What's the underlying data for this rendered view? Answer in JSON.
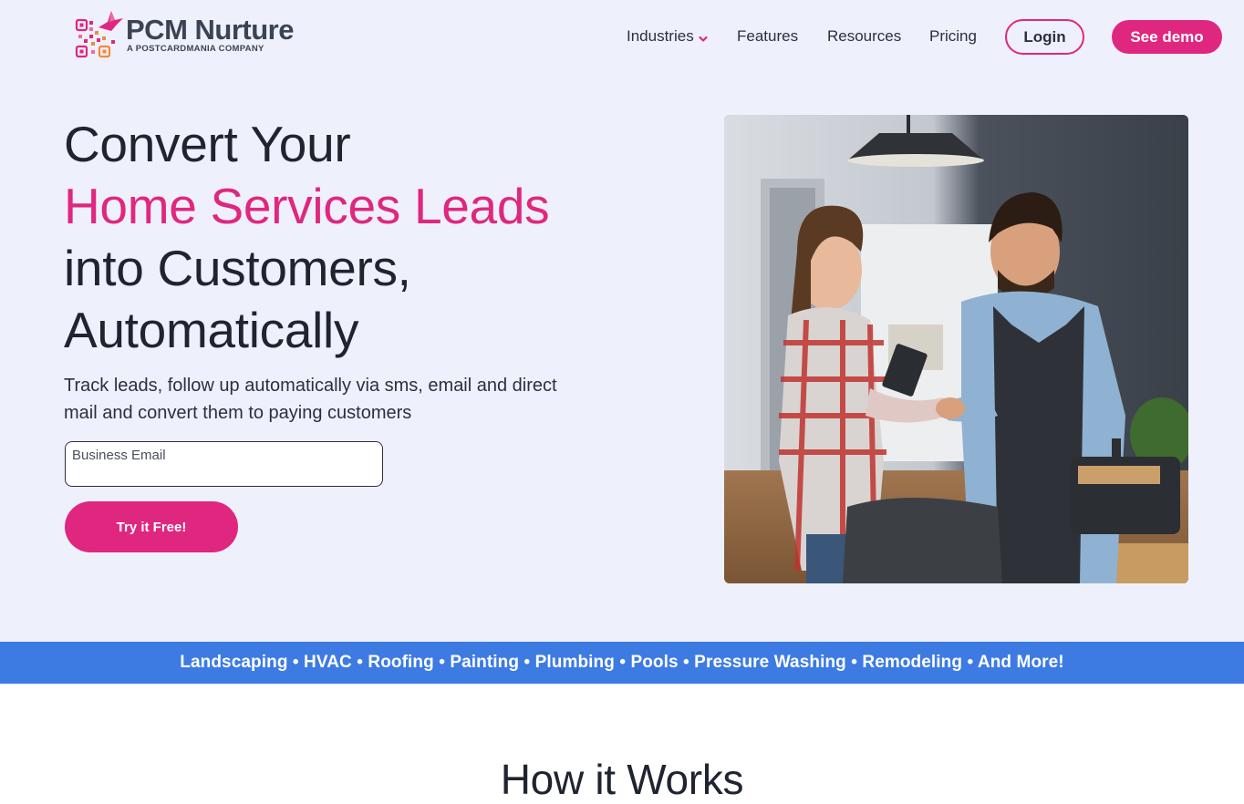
{
  "brand": {
    "name": "PCM Nurture",
    "tagline": "A POSTCARDMANIA COMPANY",
    "logo_icon": "qr-code-hummingbird-icon"
  },
  "nav": {
    "items": [
      {
        "label": "Industries",
        "has_dropdown": true
      },
      {
        "label": "Features"
      },
      {
        "label": "Resources"
      },
      {
        "label": "Pricing"
      }
    ],
    "login_label": "Login",
    "demo_label": "See demo"
  },
  "hero": {
    "headline_line1": "Convert Your",
    "headline_accent": "Home Services Leads",
    "headline_line3": "into Customers,",
    "headline_line4": "Automatically",
    "subtext": "Track leads, follow up automatically via sms, email and direct mail and convert them to paying customers",
    "email_label": "Business Email",
    "email_value": "",
    "cta_label": "Try it Free!",
    "photo_subject": "technician-handshake-photo"
  },
  "industries_band": {
    "text": "Landscaping • HVAC • Roofing • Painting • Plumbing • Pools • Pressure Washing • Remodeling • And More!"
  },
  "how_it_works": {
    "title": "How it Works"
  },
  "colors": {
    "accent": "#e0277f",
    "band": "#3d7be3",
    "hero_bg": "#eef1fc",
    "text": "#1f2430"
  }
}
